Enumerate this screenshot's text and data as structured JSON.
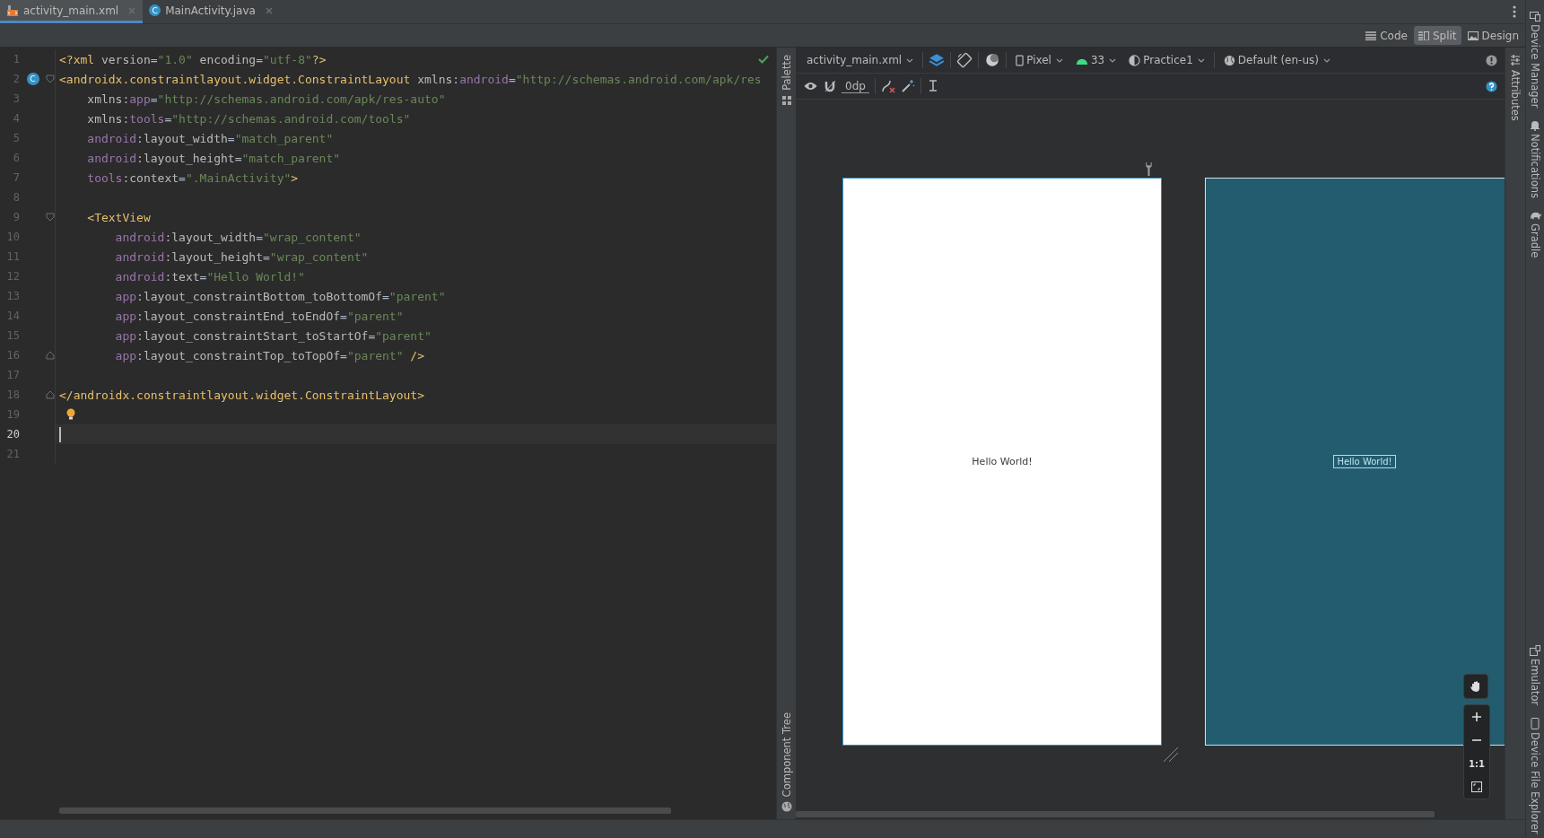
{
  "tabs": [
    {
      "label": "activity_main.xml",
      "kind": "xml",
      "selected": true
    },
    {
      "label": "MainActivity.java",
      "kind": "class",
      "icon_text": "C",
      "selected": false
    }
  ],
  "view_modes": [
    {
      "label": "Code",
      "kind": "code",
      "selected": false
    },
    {
      "label": "Split",
      "kind": "split",
      "selected": true
    },
    {
      "label": "Design",
      "kind": "design",
      "selected": false
    }
  ],
  "editor": {
    "lines": [
      {
        "number": "1",
        "current": false,
        "tokens": [
          {
            "kind": "tag",
            "text": "<?xml"
          },
          {
            "kind": "attr",
            "text": " version"
          },
          {
            "kind": "plain",
            "text": "="
          },
          {
            "kind": "value",
            "text": "\"1.0\""
          },
          {
            "kind": "attr",
            "text": " encoding"
          },
          {
            "kind": "plain",
            "text": "="
          },
          {
            "kind": "value",
            "text": "\"utf-8\""
          },
          {
            "kind": "tag",
            "text": "?>"
          }
        ]
      },
      {
        "number": "2",
        "current": false,
        "marker": {
          "kind": "class",
          "text": "C"
        },
        "fold": {
          "kind": "start"
        },
        "tokens": [
          {
            "kind": "tag",
            "text": "<androidx.constraintlayout.widget.ConstraintLayout"
          },
          {
            "kind": "attr",
            "text": " xmlns:"
          },
          {
            "kind": "ns",
            "text": "android"
          },
          {
            "kind": "plain",
            "text": "="
          },
          {
            "kind": "value",
            "text": "\"http://schemas.android.com/apk/res"
          }
        ]
      },
      {
        "number": "3",
        "current": false,
        "tokens": [
          {
            "kind": "attr",
            "text": "    xmlns:"
          },
          {
            "kind": "ns",
            "text": "app"
          },
          {
            "kind": "plain",
            "text": "="
          },
          {
            "kind": "value",
            "text": "\"http://schemas.android.com/apk/res-auto\""
          }
        ]
      },
      {
        "number": "4",
        "current": false,
        "tokens": [
          {
            "kind": "attr",
            "text": "    xmlns:"
          },
          {
            "kind": "ns",
            "text": "tools"
          },
          {
            "kind": "plain",
            "text": "="
          },
          {
            "kind": "value",
            "text": "\"http://schemas.android.com/tools\""
          }
        ]
      },
      {
        "number": "5",
        "current": false,
        "tokens": [
          {
            "kind": "ns",
            "text": "    android"
          },
          {
            "kind": "attr",
            "text": ":layout_width"
          },
          {
            "kind": "plain",
            "text": "="
          },
          {
            "kind": "value",
            "text": "\"match_parent\""
          }
        ]
      },
      {
        "number": "6",
        "current": false,
        "tokens": [
          {
            "kind": "ns",
            "text": "    android"
          },
          {
            "kind": "attr",
            "text": ":layout_height"
          },
          {
            "kind": "plain",
            "text": "="
          },
          {
            "kind": "value",
            "text": "\"match_parent\""
          }
        ]
      },
      {
        "number": "7",
        "current": false,
        "tokens": [
          {
            "kind": "ns",
            "text": "    tools"
          },
          {
            "kind": "attr",
            "text": ":context"
          },
          {
            "kind": "plain",
            "text": "="
          },
          {
            "kind": "value",
            "text": "\".MainActivity\""
          },
          {
            "kind": "tag",
            "text": ">"
          }
        ]
      },
      {
        "number": "8",
        "current": false
      },
      {
        "number": "9",
        "current": false,
        "fold": {
          "kind": "start"
        },
        "tokens": [
          {
            "kind": "tag",
            "text": "    <TextView"
          }
        ]
      },
      {
        "number": "10",
        "current": false,
        "tokens": [
          {
            "kind": "ns",
            "text": "        android"
          },
          {
            "kind": "attr",
            "text": ":layout_width"
          },
          {
            "kind": "plain",
            "text": "="
          },
          {
            "kind": "value",
            "text": "\"wrap_content\""
          }
        ]
      },
      {
        "number": "11",
        "current": false,
        "tokens": [
          {
            "kind": "ns",
            "text": "        android"
          },
          {
            "kind": "attr",
            "text": ":layout_height"
          },
          {
            "kind": "plain",
            "text": "="
          },
          {
            "kind": "value",
            "text": "\"wrap_content\""
          }
        ]
      },
      {
        "number": "12",
        "current": false,
        "tokens": [
          {
            "kind": "ns",
            "text": "        android"
          },
          {
            "kind": "attr",
            "text": ":text"
          },
          {
            "kind": "plain",
            "text": "="
          },
          {
            "kind": "value",
            "text": "\"Hello World!\""
          }
        ]
      },
      {
        "number": "13",
        "current": false,
        "tokens": [
          {
            "kind": "ns",
            "text": "        app"
          },
          {
            "kind": "attr",
            "text": ":layout_constraintBottom_toBottomOf"
          },
          {
            "kind": "plain",
            "text": "="
          },
          {
            "kind": "value",
            "text": "\"parent\""
          }
        ]
      },
      {
        "number": "14",
        "current": false,
        "tokens": [
          {
            "kind": "ns",
            "text": "        app"
          },
          {
            "kind": "attr",
            "text": ":layout_constraintEnd_toEndOf"
          },
          {
            "kind": "plain",
            "text": "="
          },
          {
            "kind": "value",
            "text": "\"parent\""
          }
        ]
      },
      {
        "number": "15",
        "current": false,
        "tokens": [
          {
            "kind": "ns",
            "text": "        app"
          },
          {
            "kind": "attr",
            "text": ":layout_constraintStart_toStartOf"
          },
          {
            "kind": "plain",
            "text": "="
          },
          {
            "kind": "value",
            "text": "\"parent\""
          }
        ]
      },
      {
        "number": "16",
        "current": false,
        "fold": {
          "kind": "end"
        },
        "tokens": [
          {
            "kind": "ns",
            "text": "        app"
          },
          {
            "kind": "attr",
            "text": ":layout_constraintTop_toTopOf"
          },
          {
            "kind": "plain",
            "text": "="
          },
          {
            "kind": "value",
            "text": "\"parent\""
          },
          {
            "kind": "tag",
            "text": " />"
          }
        ]
      },
      {
        "number": "17",
        "current": false
      },
      {
        "number": "18",
        "current": false,
        "fold": {
          "kind": "end"
        },
        "tokens": [
          {
            "kind": "tag",
            "text": "</androidx.constraintlayout.widget.ConstraintLayout>"
          }
        ]
      },
      {
        "number": "19",
        "current": false,
        "marker": {
          "kind": "bulb"
        }
      },
      {
        "number": "20",
        "current": true
      },
      {
        "number": "21",
        "current": false
      }
    ]
  },
  "design_toolbar": {
    "file": "activity_main.xml",
    "device": "Pixel",
    "api": "33",
    "theme": "Practice1",
    "locale": "Default (en-us)",
    "margin": "0dp"
  },
  "left_strip": [
    "Palette",
    "Component Tree"
  ],
  "design": {
    "preview_text": "Hello World!",
    "blueprint_text": "Hello World!",
    "zoom_reset": "1:1"
  },
  "right_strip": {
    "attributes": "Attributes",
    "tools": [
      {
        "label": "Device Manager",
        "kind": "device"
      },
      {
        "label": "Notifications",
        "kind": "bell"
      },
      {
        "label": "Gradle",
        "kind": "gradle"
      },
      {
        "label": "Emulator",
        "kind": "emulator"
      },
      {
        "label": "Device File Explorer",
        "kind": "phone"
      }
    ]
  }
}
